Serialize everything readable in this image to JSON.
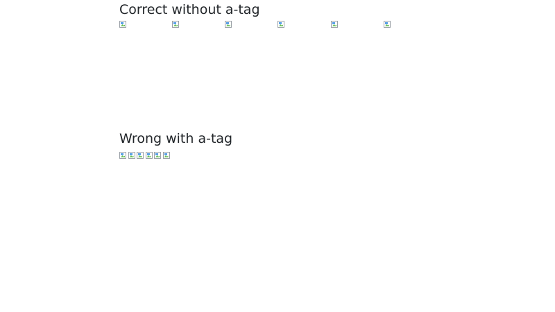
{
  "sections": {
    "correct": {
      "title": "Correct without a-tag",
      "image_count": 6,
      "image_icon": "broken-image-icon"
    },
    "wrong": {
      "title": "Wrong with a-tag",
      "image_count": 6,
      "image_icon": "broken-image-icon"
    }
  }
}
